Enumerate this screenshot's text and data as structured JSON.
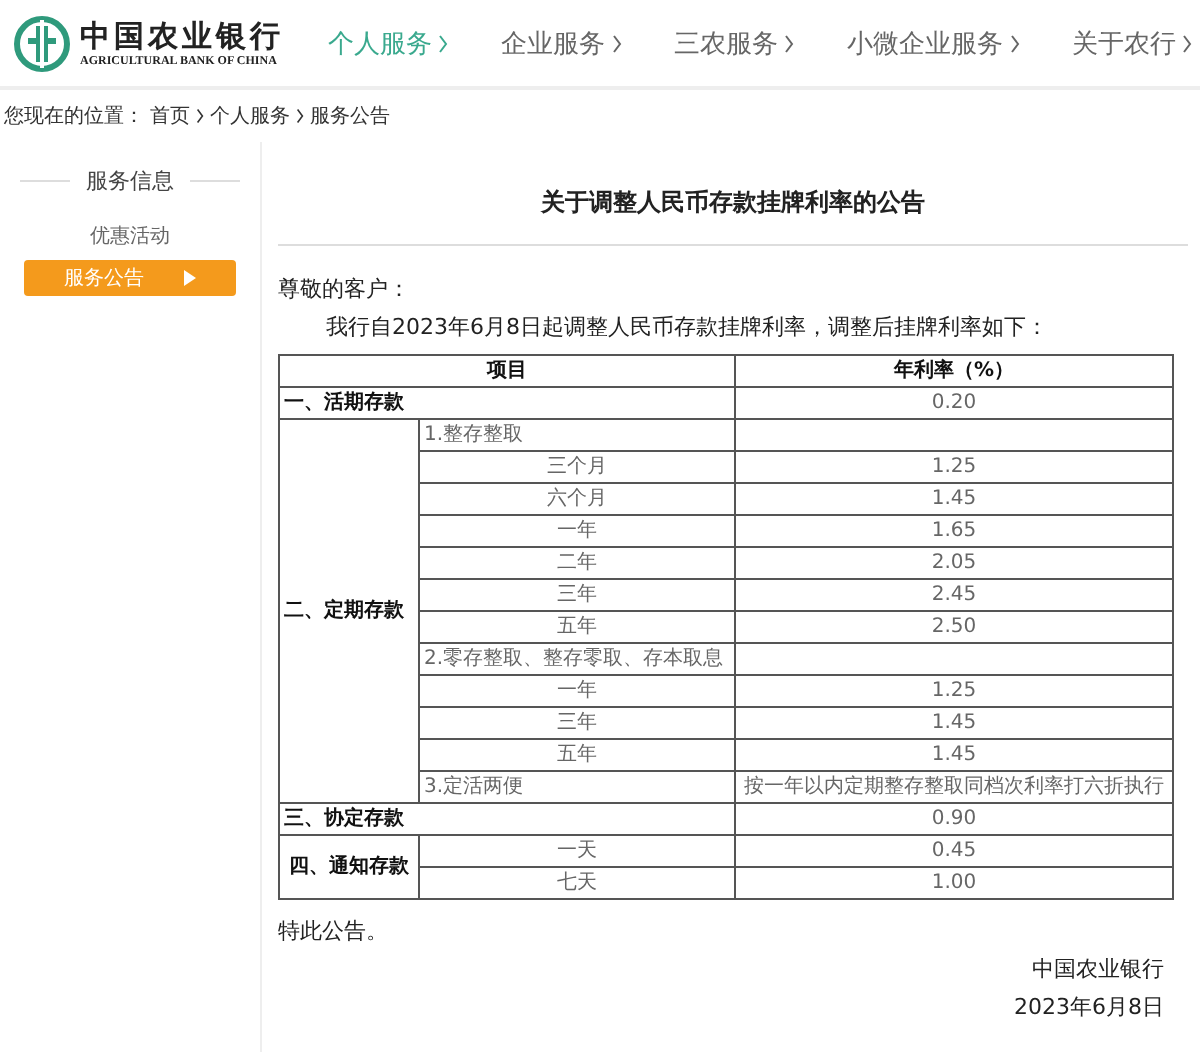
{
  "logo": {
    "name": "中国农业银行",
    "subtitle": "AGRICULTURAL BANK OF CHINA"
  },
  "nav": [
    {
      "label": "个人服务",
      "selected": true
    },
    {
      "label": "企业服务",
      "selected": false
    },
    {
      "label": "三农服务",
      "selected": false
    },
    {
      "label": "小微企业服务",
      "selected": false
    },
    {
      "label": "关于农行",
      "selected": false
    }
  ],
  "breadcrumb": {
    "prefix": "您现在的位置：",
    "items": [
      "首页",
      "个人服务",
      "服务公告"
    ]
  },
  "sidebar": {
    "title": "服务信息",
    "items": [
      {
        "label": "优惠活动",
        "selected": false
      },
      {
        "label": "服务公告",
        "selected": true
      }
    ]
  },
  "article": {
    "title": "关于调整人民币存款挂牌利率的公告",
    "greeting": "尊敬的客户：",
    "intro": "我行自2023年6月8日起调整人民币存款挂牌利率，调整后挂牌利率如下：",
    "table": {
      "columns": [
        "项目",
        "年利率（%）"
      ],
      "sections": [
        {
          "label": "一、活期存款",
          "rate": "0.20"
        },
        {
          "label": "二、定期存款",
          "groups": [
            {
              "label": "1.整存整取",
              "items": [
                {
                  "term": "三个月",
                  "rate": "1.25"
                },
                {
                  "term": "六个月",
                  "rate": "1.45"
                },
                {
                  "term": "一年",
                  "rate": "1.65"
                },
                {
                  "term": "二年",
                  "rate": "2.05"
                },
                {
                  "term": "三年",
                  "rate": "2.45"
                },
                {
                  "term": "五年",
                  "rate": "2.50"
                }
              ]
            },
            {
              "label": "2.零存整取、整存零取、存本取息",
              "items": [
                {
                  "term": "一年",
                  "rate": "1.25"
                },
                {
                  "term": "三年",
                  "rate": "1.45"
                },
                {
                  "term": "五年",
                  "rate": "1.45"
                }
              ]
            },
            {
              "label": "3.定活两便",
              "rate": "按一年以内定期整存整取同档次利率打六折执行"
            }
          ]
        },
        {
          "label": "三、协定存款",
          "rate": "0.90"
        },
        {
          "label": "四、通知存款",
          "items": [
            {
              "term": "一天",
              "rate": "0.45"
            },
            {
              "term": "七天",
              "rate": "1.00"
            }
          ]
        }
      ]
    },
    "closing": "特此公告。",
    "signature": "中国农业银行",
    "date": "2023年6月8日"
  }
}
